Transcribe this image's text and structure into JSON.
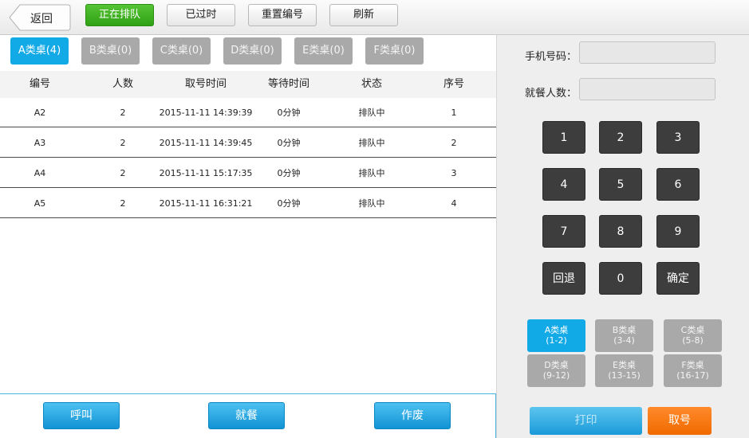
{
  "topbar": {
    "back_label": "返回",
    "buttons": [
      "正在排队",
      "已过时",
      "重置编号",
      "刷新"
    ]
  },
  "tabs": [
    "A类桌(4)",
    "B类桌(0)",
    "C类桌(0)",
    "D类桌(0)",
    "E类桌(0)",
    "F类桌(0)"
  ],
  "table": {
    "headers": [
      "编号",
      "人数",
      "取号时间",
      "等待时间",
      "状态",
      "序号"
    ],
    "rows": [
      [
        "A2",
        "2",
        "2015-11-11 14:39:39",
        "0分钟",
        "排队中",
        "1"
      ],
      [
        "A3",
        "2",
        "2015-11-11 14:39:45",
        "0分钟",
        "排队中",
        "2"
      ],
      [
        "A4",
        "2",
        "2015-11-11 15:17:35",
        "0分钟",
        "排队中",
        "3"
      ],
      [
        "A5",
        "2",
        "2015-11-11 16:31:21",
        "0分钟",
        "排队中",
        "4"
      ]
    ]
  },
  "actions": [
    "呼叫",
    "就餐",
    "作废"
  ],
  "form": {
    "phone_label": "手机号码：",
    "phone_value": "",
    "guests_label": "就餐人数：",
    "guests_value": ""
  },
  "keypad": [
    "1",
    "2",
    "3",
    "4",
    "5",
    "6",
    "7",
    "8",
    "9",
    "回退",
    "0",
    "确定"
  ],
  "table_types": [
    {
      "name": "A类桌",
      "range": "(1-2)"
    },
    {
      "name": "B类桌",
      "range": "(3-4)"
    },
    {
      "name": "C类桌",
      "range": "(5-8)"
    },
    {
      "name": "D类桌",
      "range": "(9-12)"
    },
    {
      "name": "E类桌",
      "range": "(13-15)"
    },
    {
      "name": "F类桌",
      "range": "(16-17)"
    }
  ],
  "print_label": "打印",
  "take_label": "取号",
  "colors": {
    "accent_blue": "#12a9e7",
    "active_green": "#3cb01f",
    "take_orange": "#f47a12",
    "keypad_dark": "#3d3d3d"
  }
}
